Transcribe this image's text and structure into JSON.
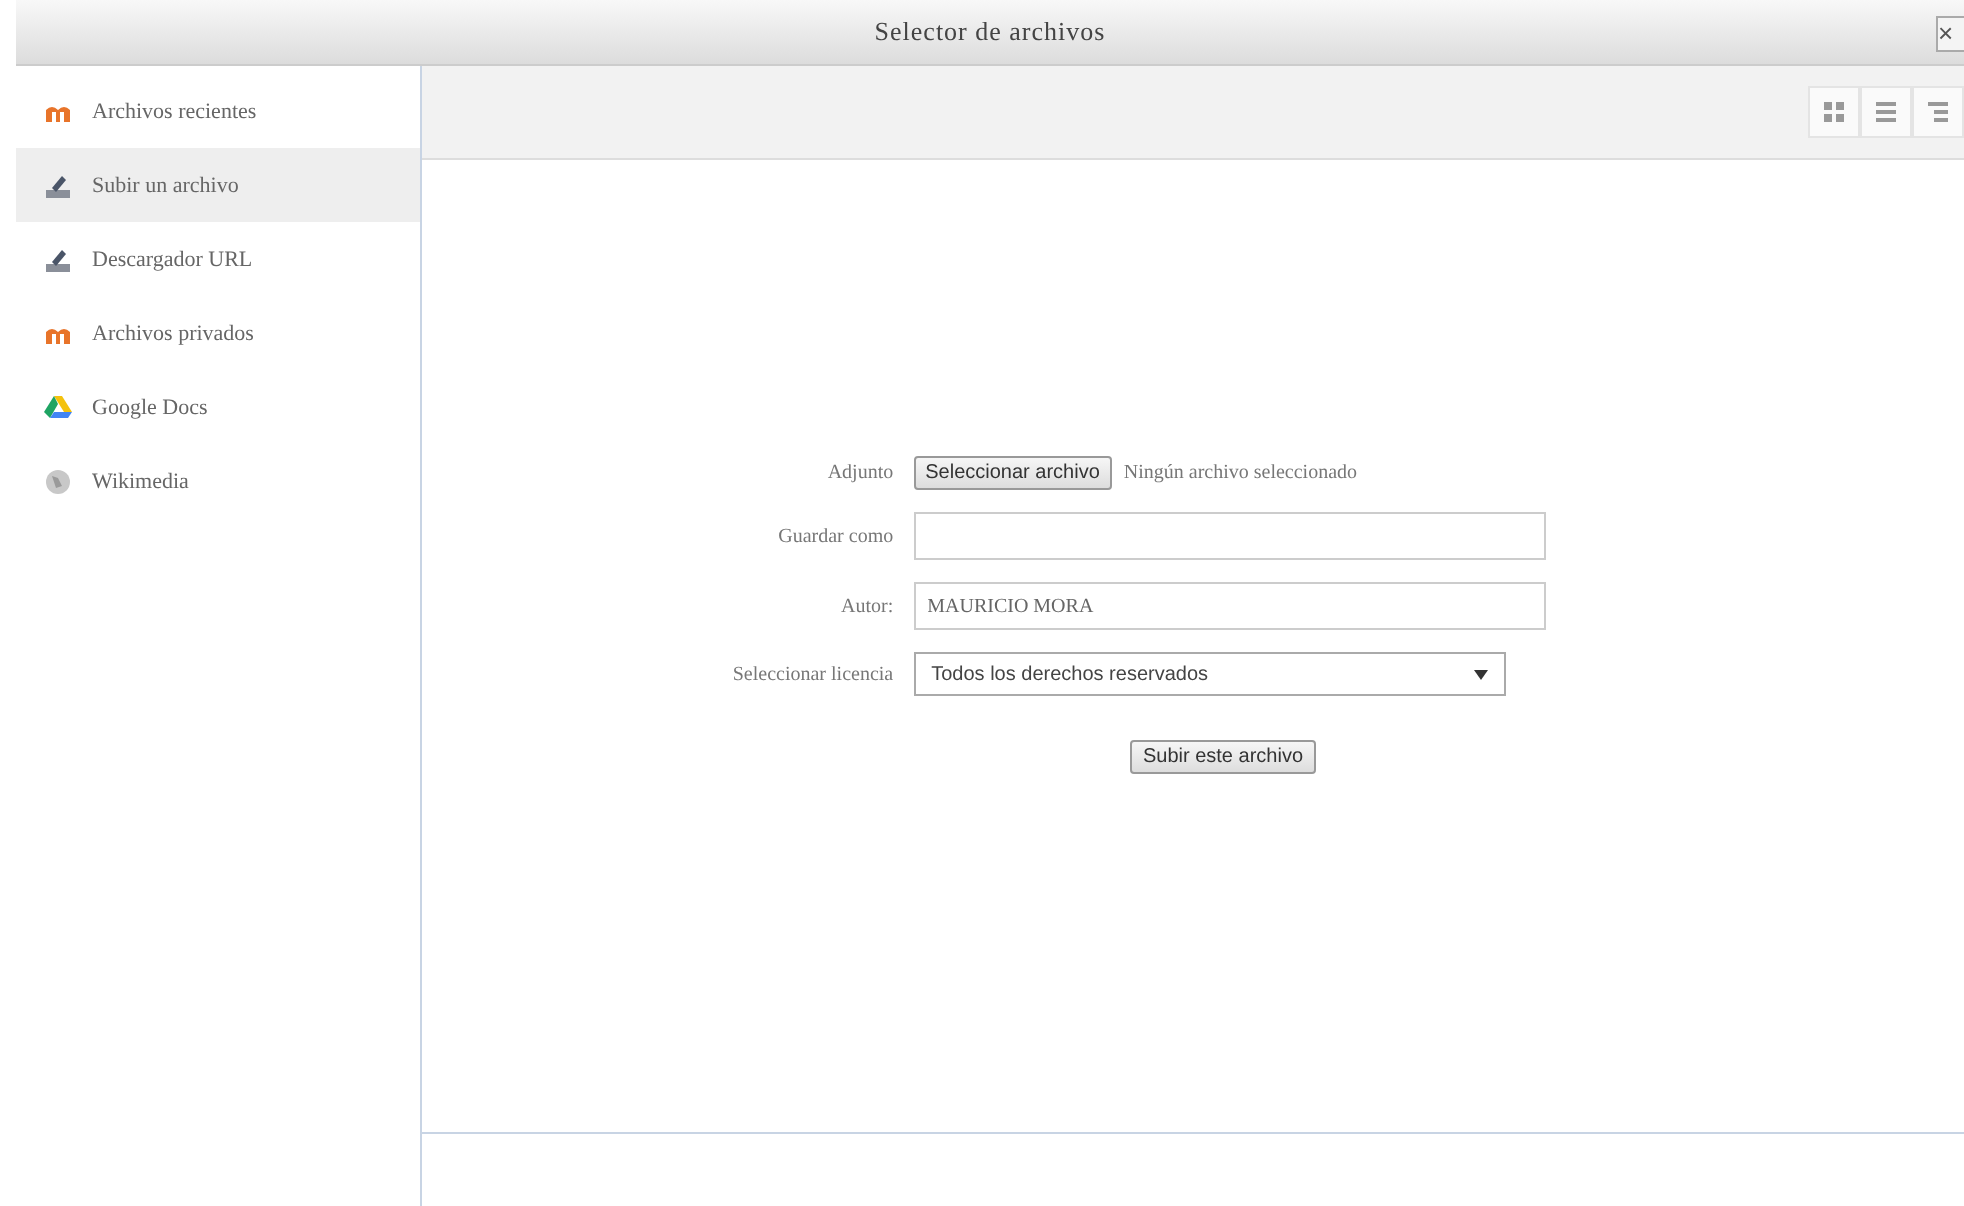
{
  "window": {
    "title": "Selector de archivos",
    "close": "×"
  },
  "sidebar": {
    "items": [
      {
        "label": "Archivos recientes",
        "kind": "moodle",
        "selected": false
      },
      {
        "label": "Subir un archivo",
        "kind": "upload",
        "selected": true
      },
      {
        "label": "Descargador URL",
        "kind": "upload",
        "selected": false
      },
      {
        "label": "Archivos privados",
        "kind": "moodle",
        "selected": false
      },
      {
        "label": "Google Docs",
        "kind": "drive",
        "selected": false
      },
      {
        "label": "Wikimedia",
        "kind": "wiki",
        "selected": false
      }
    ]
  },
  "toolbar": {
    "views": [
      {
        "kind": "icons",
        "selected": false
      },
      {
        "kind": "list",
        "selected": false
      },
      {
        "kind": "tree",
        "selected": false
      }
    ]
  },
  "form": {
    "attachment": {
      "label": "Adjunto",
      "button": "Seleccionar archivo",
      "status": "Ningún archivo seleccionado"
    },
    "save_as": {
      "label": "Guardar como"
    },
    "author": {
      "label": "Autor:",
      "value": "MAURICIO MORA"
    },
    "license": {
      "label": "Seleccionar licencia",
      "value": "Todos los derechos reservados"
    },
    "submit": "Subir este archivo"
  }
}
